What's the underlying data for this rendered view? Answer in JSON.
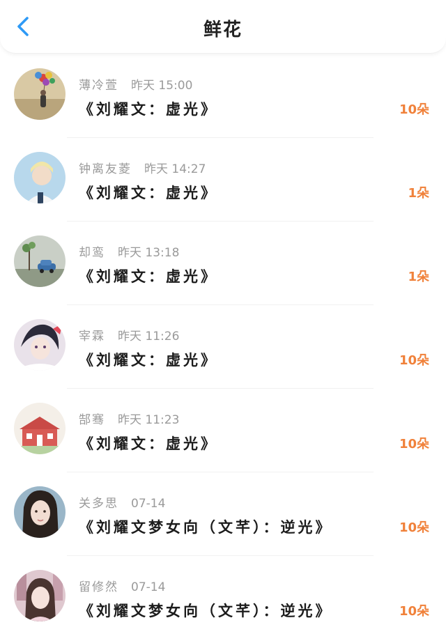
{
  "header": {
    "title": "鲜花",
    "back_icon": "chevron-left-icon",
    "accent_color": "#2e9af6"
  },
  "flowers": [
    {
      "user": "薄冷萱",
      "time": "昨天 15:00",
      "book": "《刘耀文：虚光》",
      "count": "10朵"
    },
    {
      "user": "钟离友菱",
      "time": "昨天 14:27",
      "book": "《刘耀文：虚光》",
      "count": "1朵"
    },
    {
      "user": "却鸾",
      "time": "昨天 13:18",
      "book": "《刘耀文：虚光》",
      "count": "1朵"
    },
    {
      "user": "宰霖",
      "time": "昨天 11:26",
      "book": "《刘耀文：虚光》",
      "count": "10朵"
    },
    {
      "user": "郜骞",
      "time": "昨天 11:23",
      "book": "《刘耀文：虚光》",
      "count": "10朵"
    },
    {
      "user": "关多思",
      "time": "07-14",
      "book": "《刘耀文梦女向（文芊）：逆光》",
      "count": "10朵"
    },
    {
      "user": "留修然",
      "time": "07-14",
      "book": "《刘耀文梦女向（文芊）：逆光》",
      "count": "10朵"
    }
  ],
  "count_color": "#f0813a"
}
